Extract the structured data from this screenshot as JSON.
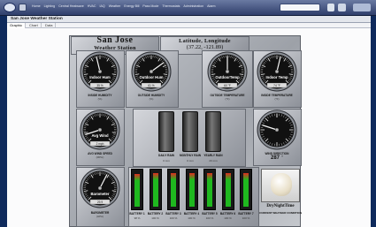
{
  "browser": {
    "nav_items": [
      "Home",
      "Lighting",
      "Central Heatwave",
      "HVAC",
      "IAQ",
      "Weather",
      "Energy Bill",
      "Pass Mode",
      "Thermostats",
      "Administration",
      "Alarm"
    ],
    "search_placeholder": "",
    "window_title": "San Jose Weather Station"
  },
  "tabs": [
    {
      "label": "Graphic",
      "active": true
    },
    {
      "label": "Chart",
      "active": false
    },
    {
      "label": "Data",
      "active": false
    }
  ],
  "station": {
    "title_line1": "San Jose",
    "title_line2": "Weather Station",
    "latlon_label": "Latitude, Longitude",
    "coords": "(37.22, -121.89)"
  },
  "gauges": {
    "indoor_hum": {
      "label": "Indoor Hum",
      "value": "35 %",
      "caption": "INSIDE HUMIDITY",
      "sub": "(%)",
      "needle": 0.45
    },
    "outdoor_hum": {
      "label": "Outdoor Hum",
      "value": "61 %",
      "caption": "OUTSIDE HUMIDITY",
      "sub": "(%)",
      "needle": 0.7
    },
    "outdoor_temp": {
      "label": "OutdoorTemp",
      "value": "60 °F",
      "caption": "OUTSIDE TEMPERATURE",
      "sub": "(°F)",
      "needle": 0.5
    },
    "indoor_temp": {
      "label": "Indoor Temp",
      "value": "74 °F",
      "caption": "INSIDE TEMPERATURE",
      "sub": "(°F)",
      "needle": 0.55
    },
    "avg_wind": {
      "label": "Avg Wind",
      "value": "2 mph",
      "caption": "AVG WIND SPEED",
      "sub": "(MPH)",
      "needle": 0.1
    },
    "barometer": {
      "label": "Barometer",
      "value": "29.9",
      "caption": "BAROMETER",
      "sub": "(HPA)",
      "needle": 0.6
    },
    "wind_direction": {
      "caption": "WIND DIRECTION",
      "value": "287",
      "unit": "°",
      "needle": 0.8
    }
  },
  "rain": [
    {
      "caption": "DAILY RAIN",
      "value": "0 mm"
    },
    {
      "caption": "MONTHLY RAIN",
      "value": "0 mm"
    },
    {
      "caption": "YEARLY RAIN",
      "value": "20 mm"
    }
  ],
  "batteries": [
    {
      "caption": "BATTERY 1",
      "value": "98 %",
      "level": 0.98
    },
    {
      "caption": "BATTERY 2",
      "value": "100 %",
      "level": 1.0
    },
    {
      "caption": "BATTERY 3",
      "value": "100 %",
      "level": 1.0
    },
    {
      "caption": "BATTERY 4",
      "value": "100 %",
      "level": 1.0
    },
    {
      "caption": "BATTERY 5",
      "value": "100 %",
      "level": 1.0
    },
    {
      "caption": "BATTERY 6",
      "value": "100 %",
      "level": 1.0
    },
    {
      "caption": "BATTERY 7",
      "value": "100 %",
      "level": 1.0
    }
  ],
  "condition": {
    "title": "DryNightTime",
    "caption": "CURRENT WEATHER CONDITION"
  },
  "colors": {
    "battery_fill": "#1fb81f",
    "battery_warn": "#e02c1f"
  }
}
